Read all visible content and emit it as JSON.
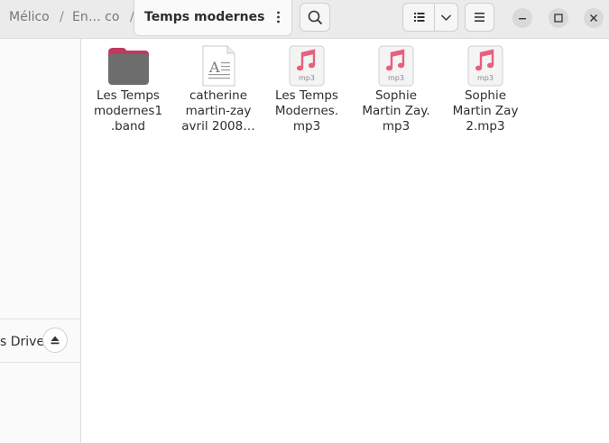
{
  "breadcrumb": {
    "items": [
      "Mélico",
      "En… co ",
      "Temps modernes"
    ],
    "separator": "/"
  },
  "toolbar": {
    "menu_icon": "vertical-ellipsis-icon",
    "search_icon": "search-icon",
    "view_icon": "list-view-icon",
    "dropdown_icon": "chevron-down-icon",
    "hamburger_icon": "hamburger-menu-icon"
  },
  "window_controls": [
    "minimize-icon",
    "maximize-icon",
    "close-icon"
  ],
  "sidebar": {
    "drive_label": "s Drive",
    "eject_icon": "eject-icon"
  },
  "files": [
    {
      "lines": [
        "Les Temps",
        "modernes1",
        ".band"
      ],
      "icon": "folder-icon"
    },
    {
      "lines": [
        "catherine",
        "martin-zay",
        "avril 2008…"
      ],
      "icon": "text-document-icon"
    },
    {
      "lines": [
        "Les Temps",
        "Modernes.",
        "mp3"
      ],
      "icon": "audio-file-icon",
      "badge": "mp3"
    },
    {
      "lines": [
        "Sophie",
        "Martin Zay.",
        "mp3"
      ],
      "icon": "audio-file-icon",
      "badge": "mp3"
    },
    {
      "lines": [
        "Sophie",
        "Martin Zay",
        "2.mp3"
      ],
      "icon": "audio-file-icon",
      "badge": "mp3"
    }
  ],
  "colors": {
    "headerbar": "#ebebeb",
    "folder_top": "#b83b5e",
    "folder_body": "#6b6b6b",
    "music_note": "#e95f7c"
  }
}
